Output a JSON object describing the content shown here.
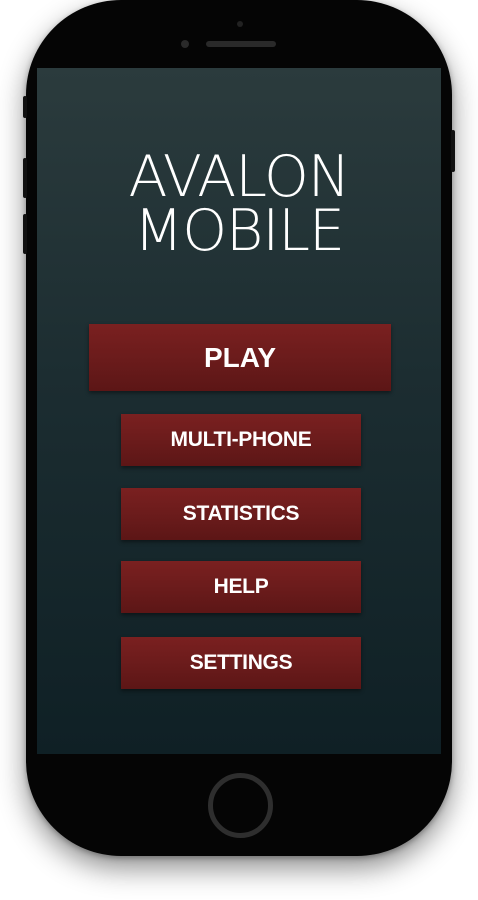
{
  "app": {
    "title_line1": "AVALON",
    "title_line2": "MOBILE"
  },
  "menu": {
    "play": "PLAY",
    "multi_phone": "MULTI-PHONE",
    "statistics": "STATISTICS",
    "help": "HELP",
    "settings": "SETTINGS"
  },
  "icons": {
    "home_button": "home-button-circle",
    "front_camera": "camera-dot",
    "speaker": "speaker-slot"
  },
  "colors": {
    "button_red": "#6a1b1b",
    "screen_top": "#2b3b3d",
    "screen_bottom": "#0f2025",
    "text": "#ffffff"
  }
}
